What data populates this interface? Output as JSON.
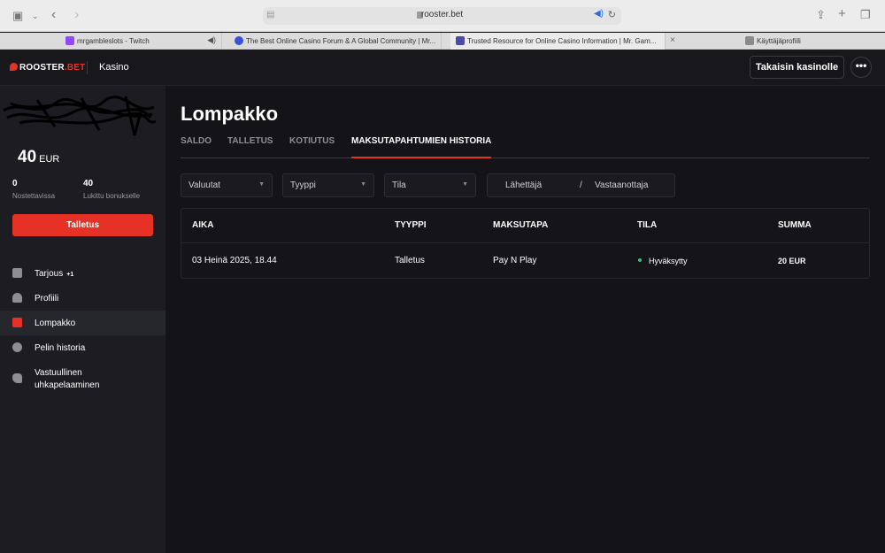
{
  "browser": {
    "url": "rooster.bet",
    "tabs": [
      {
        "title": "mrgambleslots - Twitch",
        "favicon_color": "#9146ff"
      },
      {
        "title": "The Best Online Casino Forum & A Global Community | Mr...",
        "favicon_color": "#3b4fd8"
      },
      {
        "title": "Trusted Resource for Online Casino Information | Mr. Gam...",
        "favicon_color": "#4a4aa8"
      },
      {
        "title": "Käyttäjäprofiili",
        "favicon_color": "#8a8a8a"
      }
    ]
  },
  "header": {
    "logo_text": "ROOSTER",
    "logo_suffix": ".BET",
    "section": "Kasino",
    "back_button": "Takaisin kasinolle",
    "more_button": "•••"
  },
  "sidebar": {
    "balance": "40",
    "currency": "EUR",
    "stats": [
      {
        "value": "0",
        "label": "Nostettavissa"
      },
      {
        "value": "40",
        "label": "Lukittu bonukselle"
      }
    ],
    "deposit_button": "Talletus",
    "items": [
      {
        "label": "Tarjous",
        "badge": "+1",
        "icon": "gift-icon"
      },
      {
        "label": "Profiili",
        "icon": "user-icon"
      },
      {
        "label": "Lompakko",
        "icon": "wallet-icon"
      },
      {
        "label": "Pelin historia",
        "icon": "history-icon"
      },
      {
        "label": "Vastuullinen uhkapelaaminen",
        "icon": "hand-icon"
      }
    ]
  },
  "main": {
    "title": "Lompakko",
    "tabs": [
      "SALDO",
      "TALLETUS",
      "KOTIUTUS",
      "MAKSUTAPAHTUMIEN HISTORIA"
    ],
    "filters": {
      "currency": "Valuutat",
      "type": "Tyyppi",
      "status": "Tila",
      "sender": "Lähettäjä",
      "separator": "/",
      "receiver": "Vastaanottaja"
    },
    "table": {
      "headers": [
        "AIKA",
        "TYYPPI",
        "MAKSUTAPA",
        "TILA",
        "SUMMA"
      ],
      "rows": [
        {
          "time": "03 Heinä 2025, 18.44",
          "type": "Talletus",
          "method": "Pay N Play",
          "status": "Hyväksytty",
          "amount": "20 EUR"
        }
      ]
    }
  },
  "colors": {
    "accent": "#e53126",
    "status_ok": "#2ec27e"
  }
}
